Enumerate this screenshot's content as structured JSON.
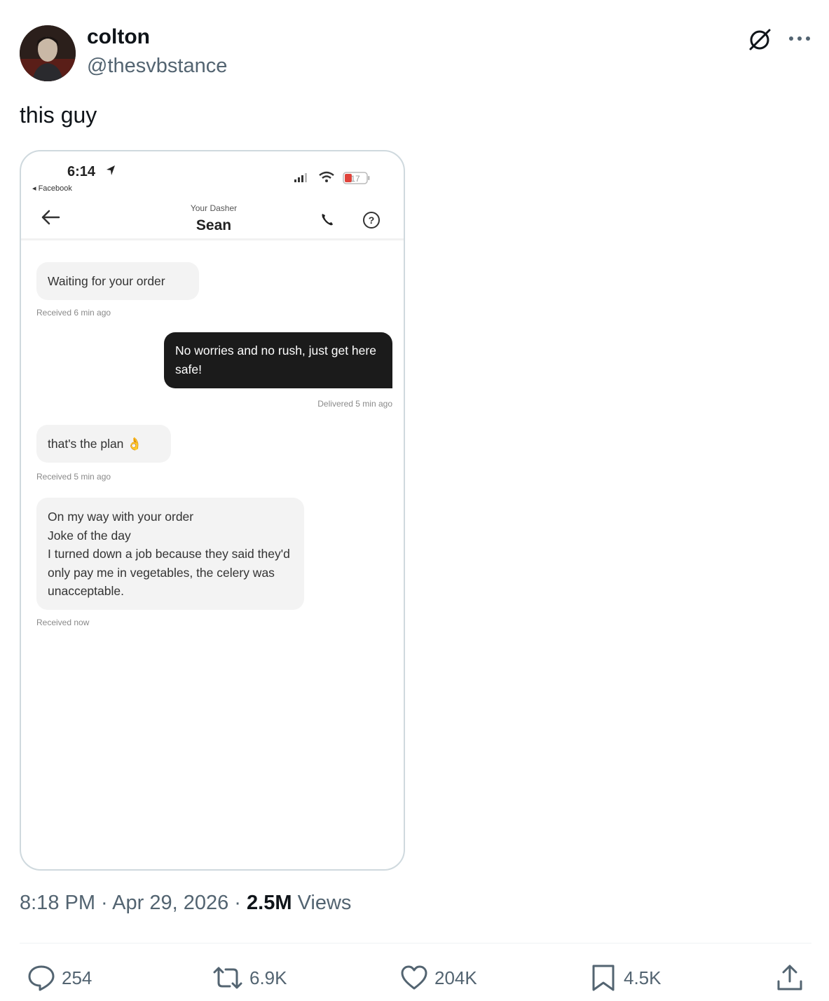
{
  "author": {
    "display_name": "colton",
    "handle": "@thesvbstance"
  },
  "tweet": {
    "text": "this guy"
  },
  "screenshot": {
    "status_time": "6:14",
    "back_app": "◂ Facebook",
    "battery": "17",
    "nav_subtitle": "Your Dasher",
    "nav_title": "Sean",
    "messages": [
      {
        "text": "Waiting for your order",
        "meta": "Received 6 min ago"
      },
      {
        "text": "No worries and no rush, just get here safe!",
        "meta": "Delivered 5 min ago"
      },
      {
        "text": "that's the plan 👌",
        "meta": "Received 5 min ago"
      },
      {
        "text": "On my way with your order\nJoke of the day\nI turned down a job because they said they'd only pay me in vegetables, the celery was unacceptable.",
        "meta": "Received now"
      }
    ]
  },
  "meta": {
    "time": "8:18 PM",
    "separator": " · ",
    "date": "Apr 29, 2026",
    "views_count": "2.5M",
    "views_label": " Views"
  },
  "actions": {
    "replies": "254",
    "reposts": "6.9K",
    "likes": "204K",
    "bookmarks": "4.5K"
  },
  "colors": {
    "text_primary": "#0f1419",
    "text_secondary": "#536471",
    "border": "#cfd9de",
    "outgoing_bubble": "#1b1b1b"
  },
  "icons": {
    "grok": "grok-icon",
    "more": "more-icon",
    "reply": "reply-icon",
    "repost": "repost-icon",
    "like": "heart-icon",
    "bookmark": "bookmark-icon",
    "share": "share-icon"
  }
}
